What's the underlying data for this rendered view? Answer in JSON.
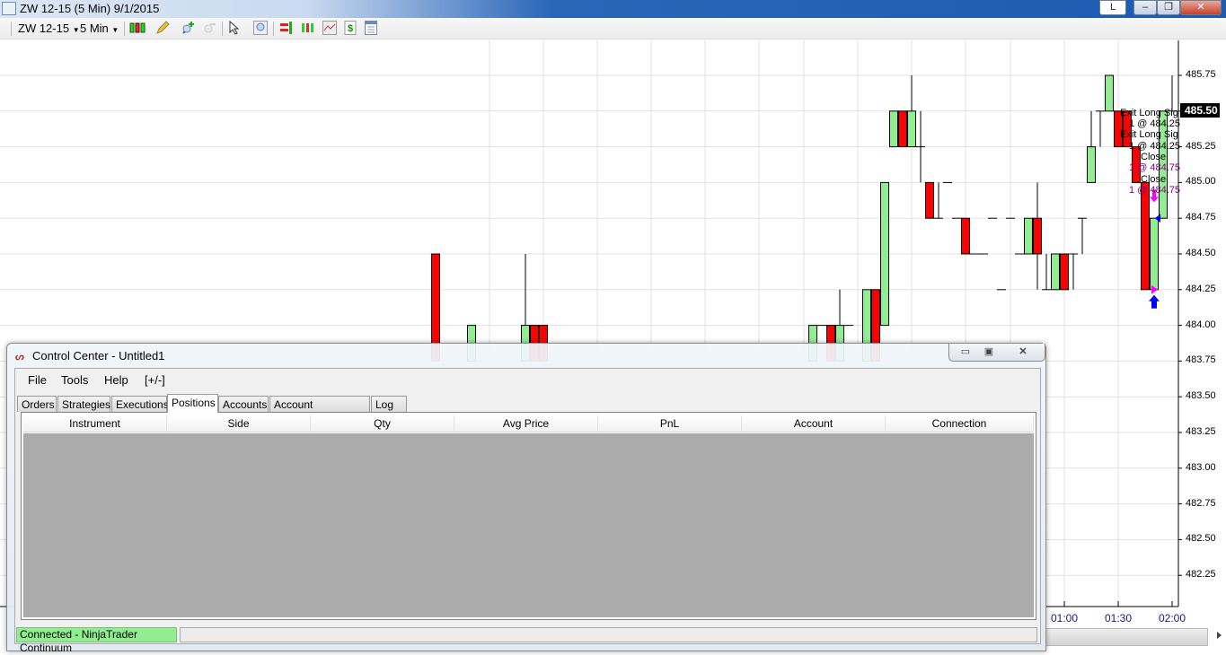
{
  "window": {
    "title": "ZW 12-15 (5 Min)  9/1/2015",
    "layout_button": "L"
  },
  "toolbar": {
    "instrument": "ZW 12-15",
    "interval": "5 Min",
    "icons": [
      "candlestick-style-icon",
      "pencil-draw-icon",
      "zoom-in-icon",
      "zoom-out-icon",
      "cursor-pointer-icon",
      "magnify-icon",
      "order-entry-icon",
      "bars-icon",
      "indicators-icon",
      "strategy-dollar-icon",
      "properties-icon"
    ]
  },
  "chart_data": {
    "type": "candlestick",
    "y_ticks": [
      "485.75",
      "485.50",
      "485.25",
      "485.00",
      "484.75",
      "484.50",
      "484.25",
      "484.00",
      "483.75",
      "483.50",
      "483.25",
      "483.00",
      "482.75",
      "482.50",
      "482.25"
    ],
    "ylim": [
      482.25,
      485.75
    ],
    "x_ticks": [
      "01:00",
      "01:30",
      "02:00"
    ],
    "last_price": "485.50",
    "colors": {
      "up": "#90ee90",
      "down": "#ff0000",
      "label_exit": "#000000",
      "label_close": "#800080",
      "exit_marker": "#ff00ff",
      "entry_marker": "#0000ff"
    },
    "bars": [
      {
        "t": "19:10",
        "o": 484.5,
        "h": 484.5,
        "l": 483.75,
        "c": 483.75
      },
      {
        "t": "19:30",
        "o": 483.75,
        "h": 484.0,
        "l": 483.75,
        "c": 484.0
      },
      {
        "t": "20:00",
        "o": 483.75,
        "h": 484.5,
        "l": 483.75,
        "c": 484.0
      },
      {
        "t": "20:05",
        "o": 484.0,
        "h": 484.0,
        "l": 483.75,
        "c": 483.75
      },
      {
        "t": "20:10",
        "o": 484.0,
        "h": 484.0,
        "l": 483.75,
        "c": 483.75
      },
      {
        "t": "22:40",
        "o": 483.75,
        "h": 484.0,
        "l": 483.75,
        "c": 484.0
      },
      {
        "t": "22:45",
        "o": 484.0,
        "h": 484.0,
        "l": 484.0,
        "c": 484.0
      },
      {
        "t": "22:50",
        "o": 484.0,
        "h": 484.0,
        "l": 483.75,
        "c": 483.75
      },
      {
        "t": "22:55",
        "o": 483.75,
        "h": 484.25,
        "l": 483.75,
        "c": 484.0
      },
      {
        "t": "23:00",
        "o": 484.0,
        "h": 484.0,
        "l": 484.0,
        "c": 484.0
      },
      {
        "t": "23:10",
        "o": 483.75,
        "h": 484.25,
        "l": 483.75,
        "c": 484.25
      },
      {
        "t": "23:15",
        "o": 484.25,
        "h": 484.25,
        "l": 483.75,
        "c": 483.75
      },
      {
        "t": "23:20",
        "o": 484.0,
        "h": 485.0,
        "l": 484.0,
        "c": 485.0
      },
      {
        "t": "23:25",
        "o": 485.25,
        "h": 485.5,
        "l": 485.25,
        "c": 485.5
      },
      {
        "t": "23:30",
        "o": 485.5,
        "h": 485.5,
        "l": 485.25,
        "c": 485.25
      },
      {
        "t": "23:35",
        "o": 485.25,
        "h": 485.75,
        "l": 485.25,
        "c": 485.5
      },
      {
        "t": "23:40",
        "o": 485.25,
        "h": 485.5,
        "l": 485.0,
        "c": 485.25
      },
      {
        "t": "23:45",
        "o": 485.0,
        "h": 485.0,
        "l": 484.75,
        "c": 484.75
      },
      {
        "t": "23:50",
        "o": 484.75,
        "h": 485.0,
        "l": 484.75,
        "c": 484.75
      },
      {
        "t": "23:55",
        "o": 485.0,
        "h": 485.0,
        "l": 485.0,
        "c": 485.0
      },
      {
        "t": "00:00",
        "o": 484.75,
        "h": 484.75,
        "l": 484.75,
        "c": 484.75
      },
      {
        "t": "00:05",
        "o": 484.75,
        "h": 484.75,
        "l": 484.5,
        "c": 484.5
      },
      {
        "t": "00:10",
        "o": 484.5,
        "h": 484.5,
        "l": 484.5,
        "c": 484.5
      },
      {
        "t": "00:15",
        "o": 484.5,
        "h": 484.5,
        "l": 484.5,
        "c": 484.5
      },
      {
        "t": "00:20",
        "o": 484.75,
        "h": 484.75,
        "l": 484.75,
        "c": 484.75
      },
      {
        "t": "00:25",
        "o": 484.25,
        "h": 484.25,
        "l": 484.25,
        "c": 484.25
      },
      {
        "t": "00:30",
        "o": 484.75,
        "h": 484.75,
        "l": 484.75,
        "c": 484.75
      },
      {
        "t": "00:35",
        "o": 484.5,
        "h": 484.5,
        "l": 484.5,
        "c": 484.5
      },
      {
        "t": "00:40",
        "o": 484.5,
        "h": 484.75,
        "l": 484.5,
        "c": 484.75
      },
      {
        "t": "00:45",
        "o": 484.75,
        "h": 485.0,
        "l": 484.25,
        "c": 484.5
      },
      {
        "t": "00:50",
        "o": 484.25,
        "h": 484.5,
        "l": 484.25,
        "c": 484.25
      },
      {
        "t": "00:55",
        "o": 484.25,
        "h": 484.5,
        "l": 484.25,
        "c": 484.5
      },
      {
        "t": "01:00",
        "o": 484.5,
        "h": 484.5,
        "l": 484.25,
        "c": 484.25
      },
      {
        "t": "01:05",
        "o": 484.5,
        "h": 484.5,
        "l": 484.25,
        "c": 484.5
      },
      {
        "t": "01:10",
        "o": 484.75,
        "h": 484.75,
        "l": 484.5,
        "c": 484.75
      },
      {
        "t": "01:15",
        "o": 485.0,
        "h": 485.5,
        "l": 485.0,
        "c": 485.25
      },
      {
        "t": "01:20",
        "o": 485.5,
        "h": 485.5,
        "l": 485.25,
        "c": 485.5
      },
      {
        "t": "01:25",
        "o": 485.5,
        "h": 485.75,
        "l": 485.5,
        "c": 485.75
      },
      {
        "t": "01:30",
        "o": 485.5,
        "h": 485.5,
        "l": 485.25,
        "c": 485.25
      },
      {
        "t": "01:35",
        "o": 485.5,
        "h": 485.5,
        "l": 485.25,
        "c": 485.25
      },
      {
        "t": "01:40",
        "o": 485.25,
        "h": 485.25,
        "l": 485.0,
        "c": 485.0
      },
      {
        "t": "01:45",
        "o": 485.0,
        "h": 485.0,
        "l": 484.25,
        "c": 484.25
      },
      {
        "t": "01:50",
        "o": 484.25,
        "h": 484.75,
        "l": 484.25,
        "c": 484.75
      },
      {
        "t": "01:55",
        "o": 484.75,
        "h": 485.5,
        "l": 484.75,
        "c": 485.5
      },
      {
        "t": "02:00",
        "o": 485.5,
        "h": 485.75,
        "l": 485.5,
        "c": 485.5
      }
    ],
    "annotations": [
      {
        "text": "Exit Long Sig",
        "kind": "exit"
      },
      {
        "text": "1 @ 484.25",
        "kind": "exit"
      },
      {
        "text": "Exit Long Sig",
        "kind": "exit"
      },
      {
        "text": "1 @ 484.25",
        "kind": "exit"
      },
      {
        "text": "Close",
        "kind": "exit"
      },
      {
        "text": "1 @ 484.75",
        "kind": "close"
      },
      {
        "text": "Close",
        "kind": "exit"
      },
      {
        "text": "1 @ 484.75",
        "kind": "close"
      }
    ]
  },
  "control_center": {
    "title": "Control Center - Untitled1",
    "menu": [
      "File",
      "Tools",
      "Help",
      "[+/-]"
    ],
    "tabs": [
      "Orders",
      "Strategies",
      "Executions",
      "Positions",
      "Accounts",
      "Account Performance",
      "Log"
    ],
    "active_tab": "Positions",
    "columns": [
      "Instrument",
      "Side",
      "Qty",
      "Avg Price",
      "PnL",
      "Account",
      "Connection"
    ],
    "rows": [],
    "status": "Connected - NinjaTrader Continuum"
  }
}
